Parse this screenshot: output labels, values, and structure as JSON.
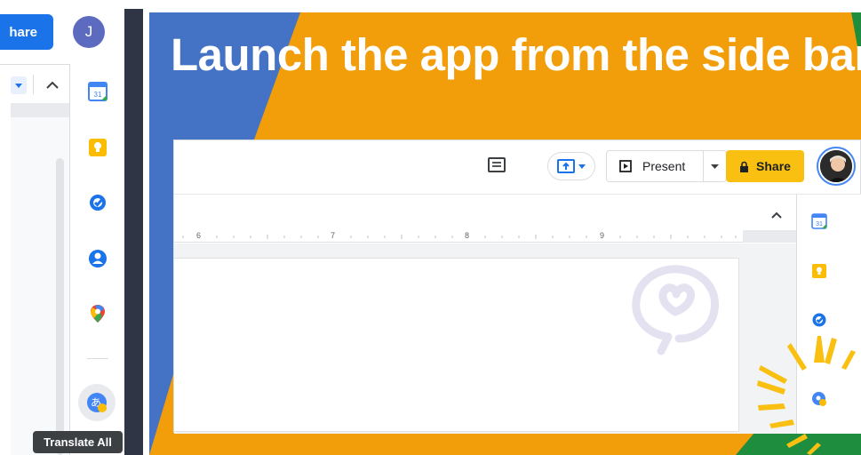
{
  "left_panel": {
    "share_label": "hare",
    "avatar_initial": "J",
    "side_icons": [
      "calendar-icon",
      "keep-icon",
      "tasks-icon",
      "contacts-icon",
      "maps-icon"
    ],
    "calendar_day": "31",
    "translate_glyph": "あ",
    "tooltip": "Translate All"
  },
  "slide": {
    "title": "Launch the app from the side bar",
    "colors": {
      "orange": "#f29d0a",
      "blue": "#4472c4",
      "green": "#1e8e3e",
      "yellow": "#f9c012"
    },
    "toolbar": {
      "present_label": "Present",
      "share_label": "Share"
    },
    "ruler_numbers": [
      "6",
      "7",
      "8",
      "9"
    ],
    "sidebar_icons": [
      "calendar-icon",
      "keep-icon",
      "tasks-icon",
      "translate-icon"
    ],
    "calendar_day": "31"
  }
}
